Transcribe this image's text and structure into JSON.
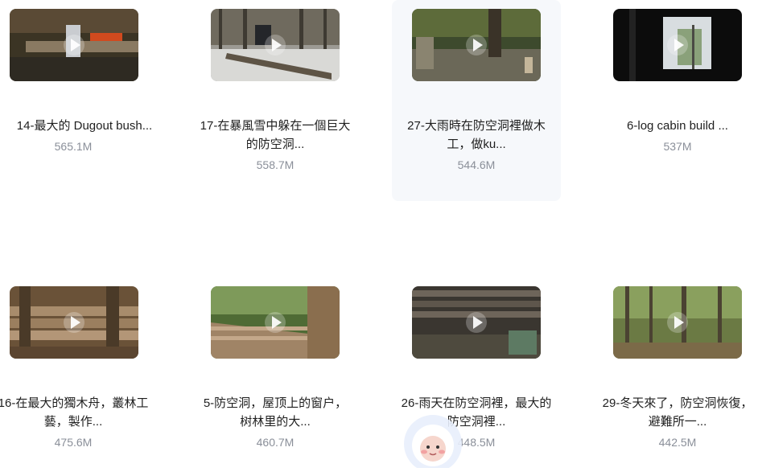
{
  "files": [
    {
      "title": "14-最大的 Dugout bush...",
      "size": "565.1M"
    },
    {
      "title": "17-在暴風雪中躲在一個巨大的防空洞...",
      "size": "558.7M"
    },
    {
      "title": "27-大雨時在防空洞裡做木工，做ku...",
      "size": "544.6M"
    },
    {
      "title": "6-log cabin build ...",
      "size": "537M"
    },
    {
      "title": "16-在最大的獨木舟，叢林工藝，製作...",
      "size": "475.6M"
    },
    {
      "title": "5-防空洞，屋顶上的窗户，树林里的大...",
      "size": "460.7M"
    },
    {
      "title": "26-雨天在防空洞裡，最大的防空洞裡...",
      "size": "448.5M"
    },
    {
      "title": "29-冬天來了，防空洞恢復，避難所一...",
      "size": "442.5M"
    }
  ],
  "icons": {
    "play": "play-icon",
    "assistant": "assistant-mascot-icon"
  }
}
